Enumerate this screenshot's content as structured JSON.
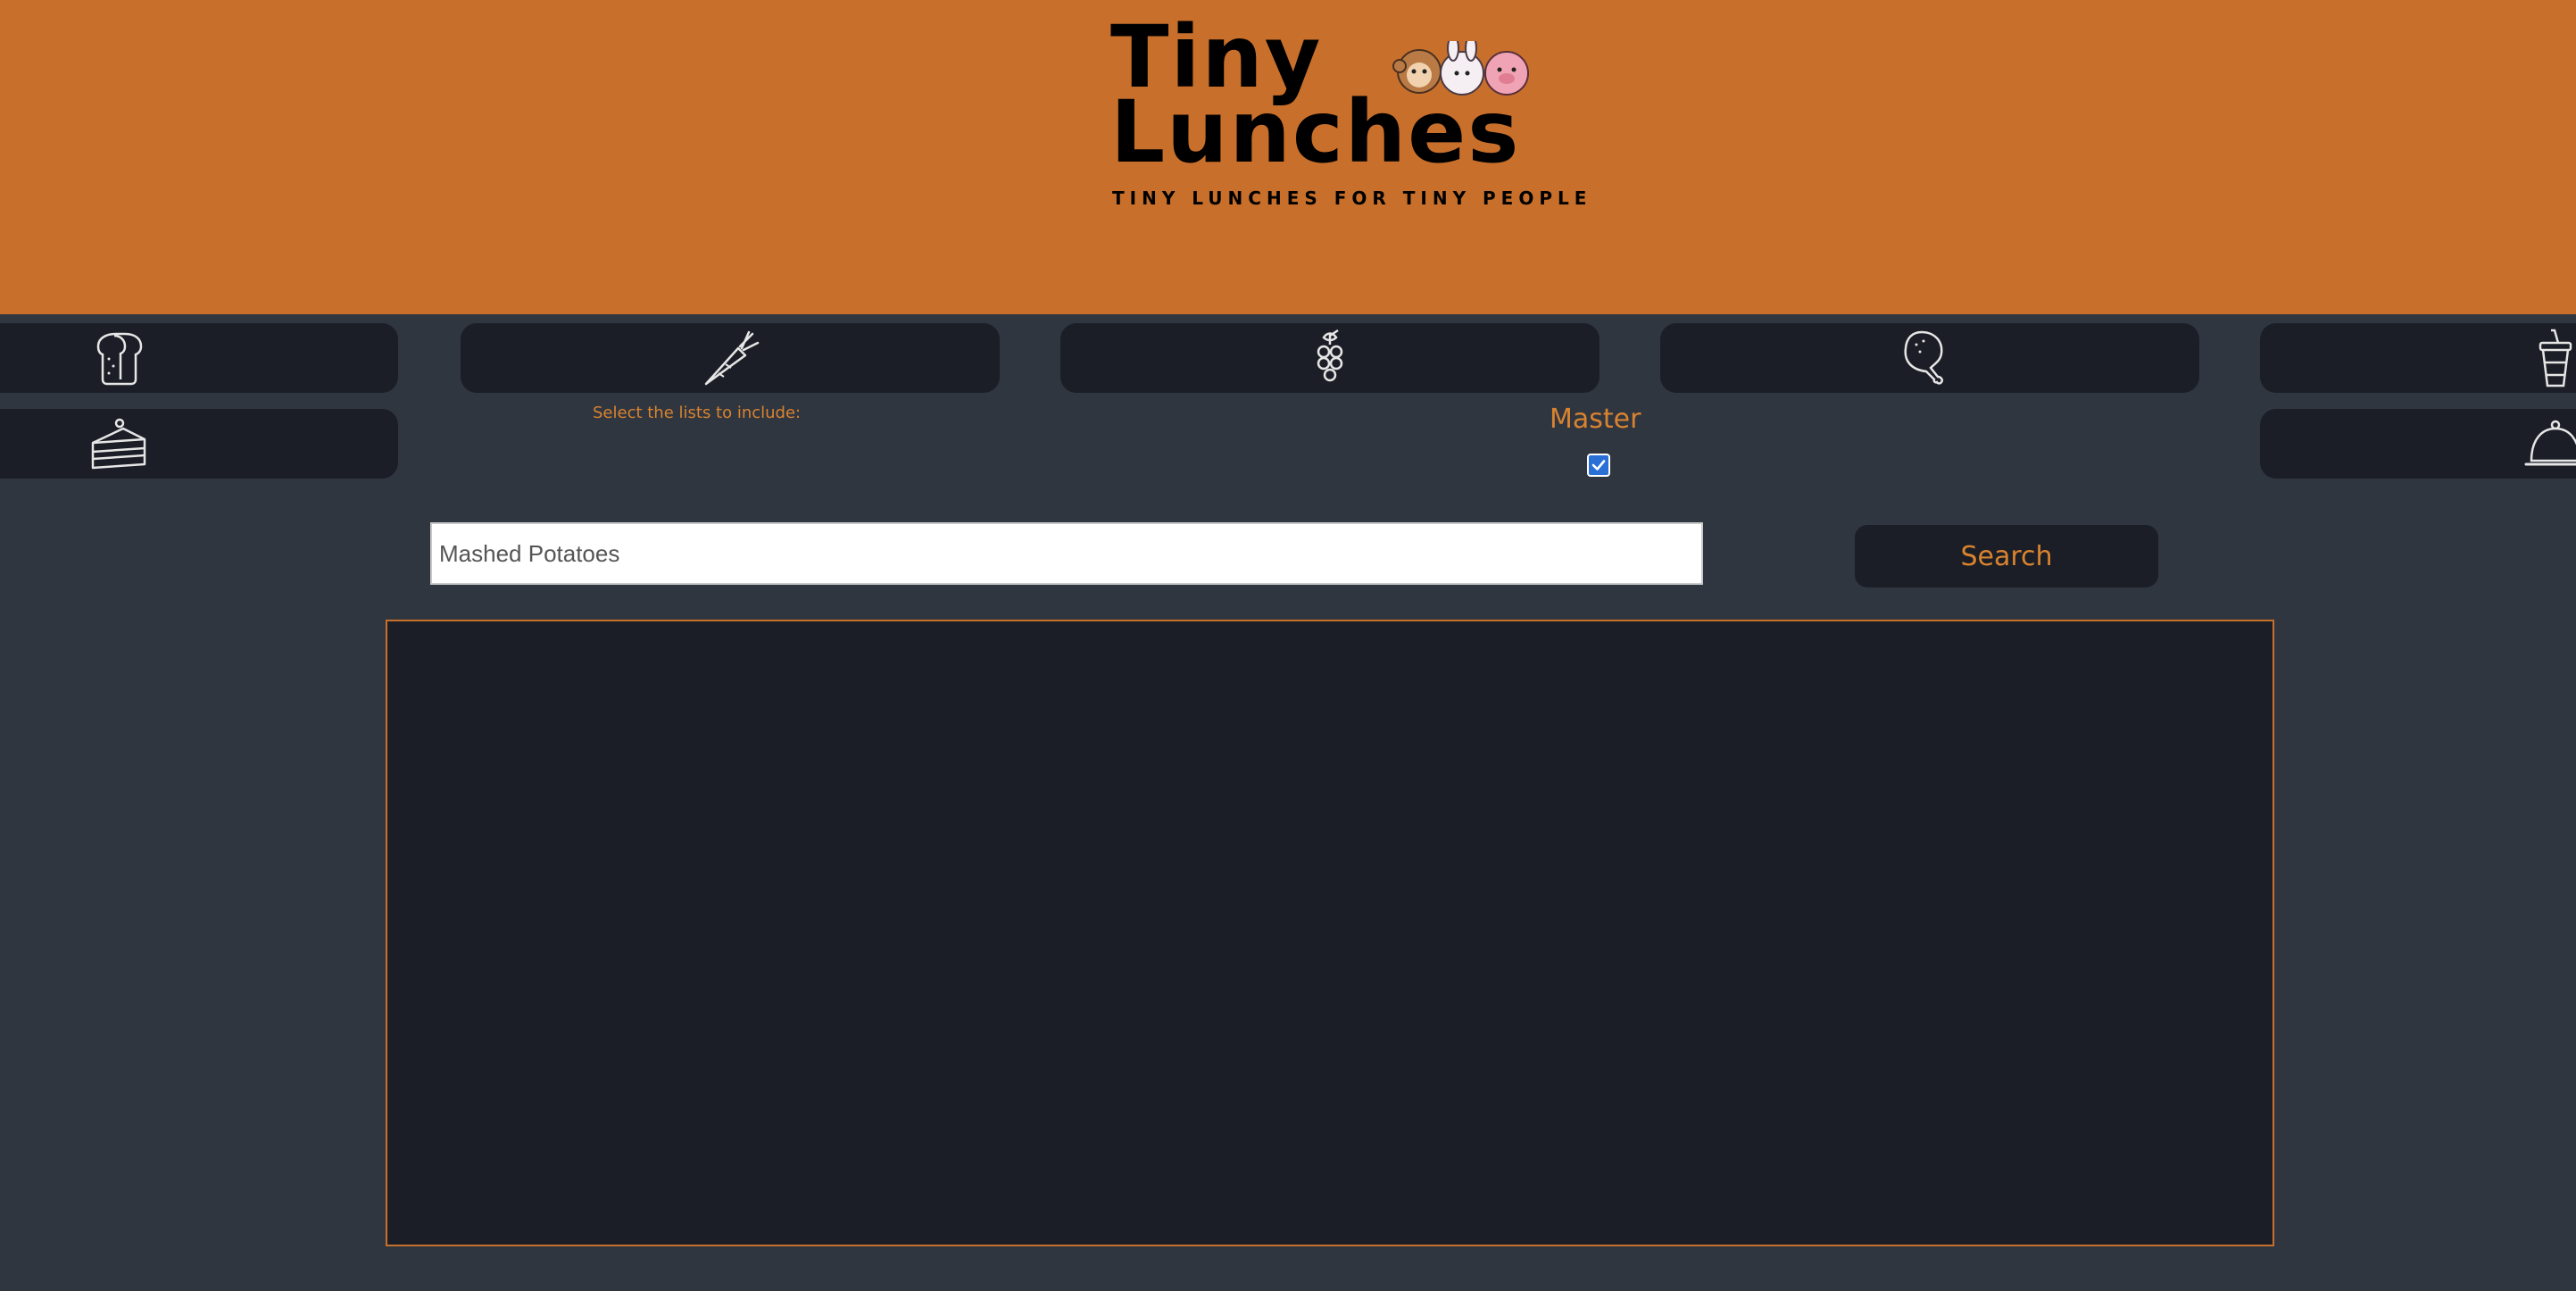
{
  "header": {
    "logo_line1": "Tiny",
    "logo_line2": "Lunches",
    "tagline": "TINY LUNCHES FOR TINY PEOPLE",
    "background_color": "#c86f2b"
  },
  "categories": [
    {
      "icon": "bread-icon"
    },
    {
      "icon": "carrot-icon"
    },
    {
      "icon": "grapes-icon"
    },
    {
      "icon": "chicken-leg-icon"
    },
    {
      "icon": "drink-cup-icon"
    },
    {
      "icon": "cake-slice-icon"
    },
    {
      "icon": "cloche-icon"
    }
  ],
  "filters": {
    "select_label": "Select the lists to include:",
    "master_label": "Master",
    "master_checked": true
  },
  "search": {
    "value": "Mashed Potatoes",
    "button_label": "Search"
  },
  "colors": {
    "accent": "#d9832f",
    "panel": "#1b1e26",
    "page_bg": "#2f3640"
  }
}
